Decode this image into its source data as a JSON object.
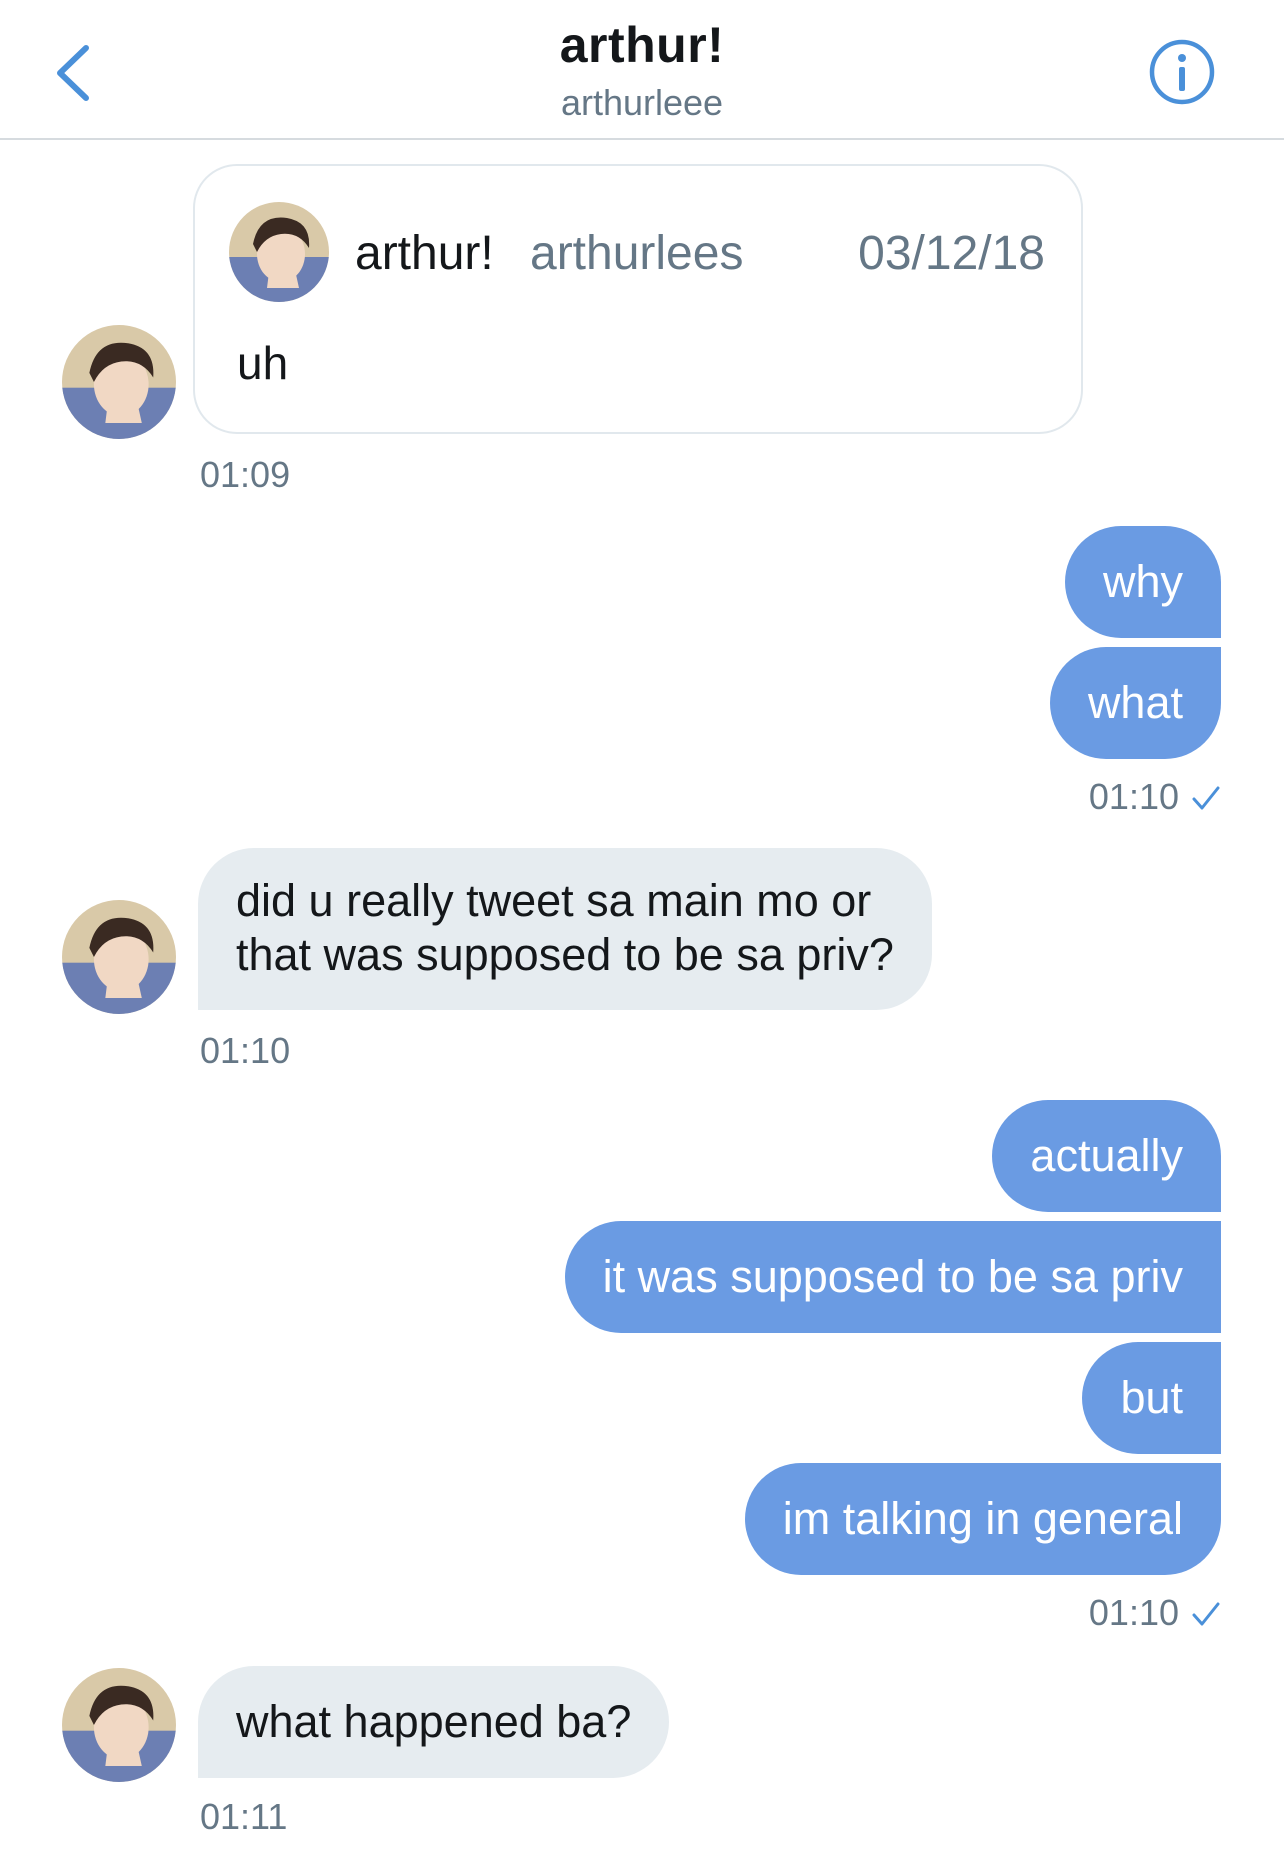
{
  "header": {
    "title": "arthur!",
    "subtitle": "arthurleee",
    "back_icon": "chevron-left-icon",
    "info_icon": "info-icon",
    "accent_color": "#4a90d9"
  },
  "quoted_tweet": {
    "name": "arthur!",
    "handle": "arthurlees",
    "date": "03/12/18",
    "text": "uh"
  },
  "messages": [
    {
      "from": "them",
      "time": "01:09"
    },
    {
      "from": "me",
      "texts": [
        "why",
        "what"
      ],
      "time": "01:10"
    },
    {
      "from": "them",
      "texts": [
        "did u really tweet sa main mo or",
        "that was supposed to be sa priv?"
      ],
      "time": "01:10"
    },
    {
      "from": "me",
      "texts": [
        "actually",
        "it was supposed to be sa priv",
        "but",
        "im talking in general"
      ],
      "time": "01:10"
    },
    {
      "from": "them",
      "texts": [
        "what happened ba?"
      ],
      "time": "01:11"
    }
  ],
  "colors": {
    "outgoing_bubble": "#6a9be3",
    "incoming_bubble": "#e6ecf0",
    "muted_text": "#657786"
  }
}
